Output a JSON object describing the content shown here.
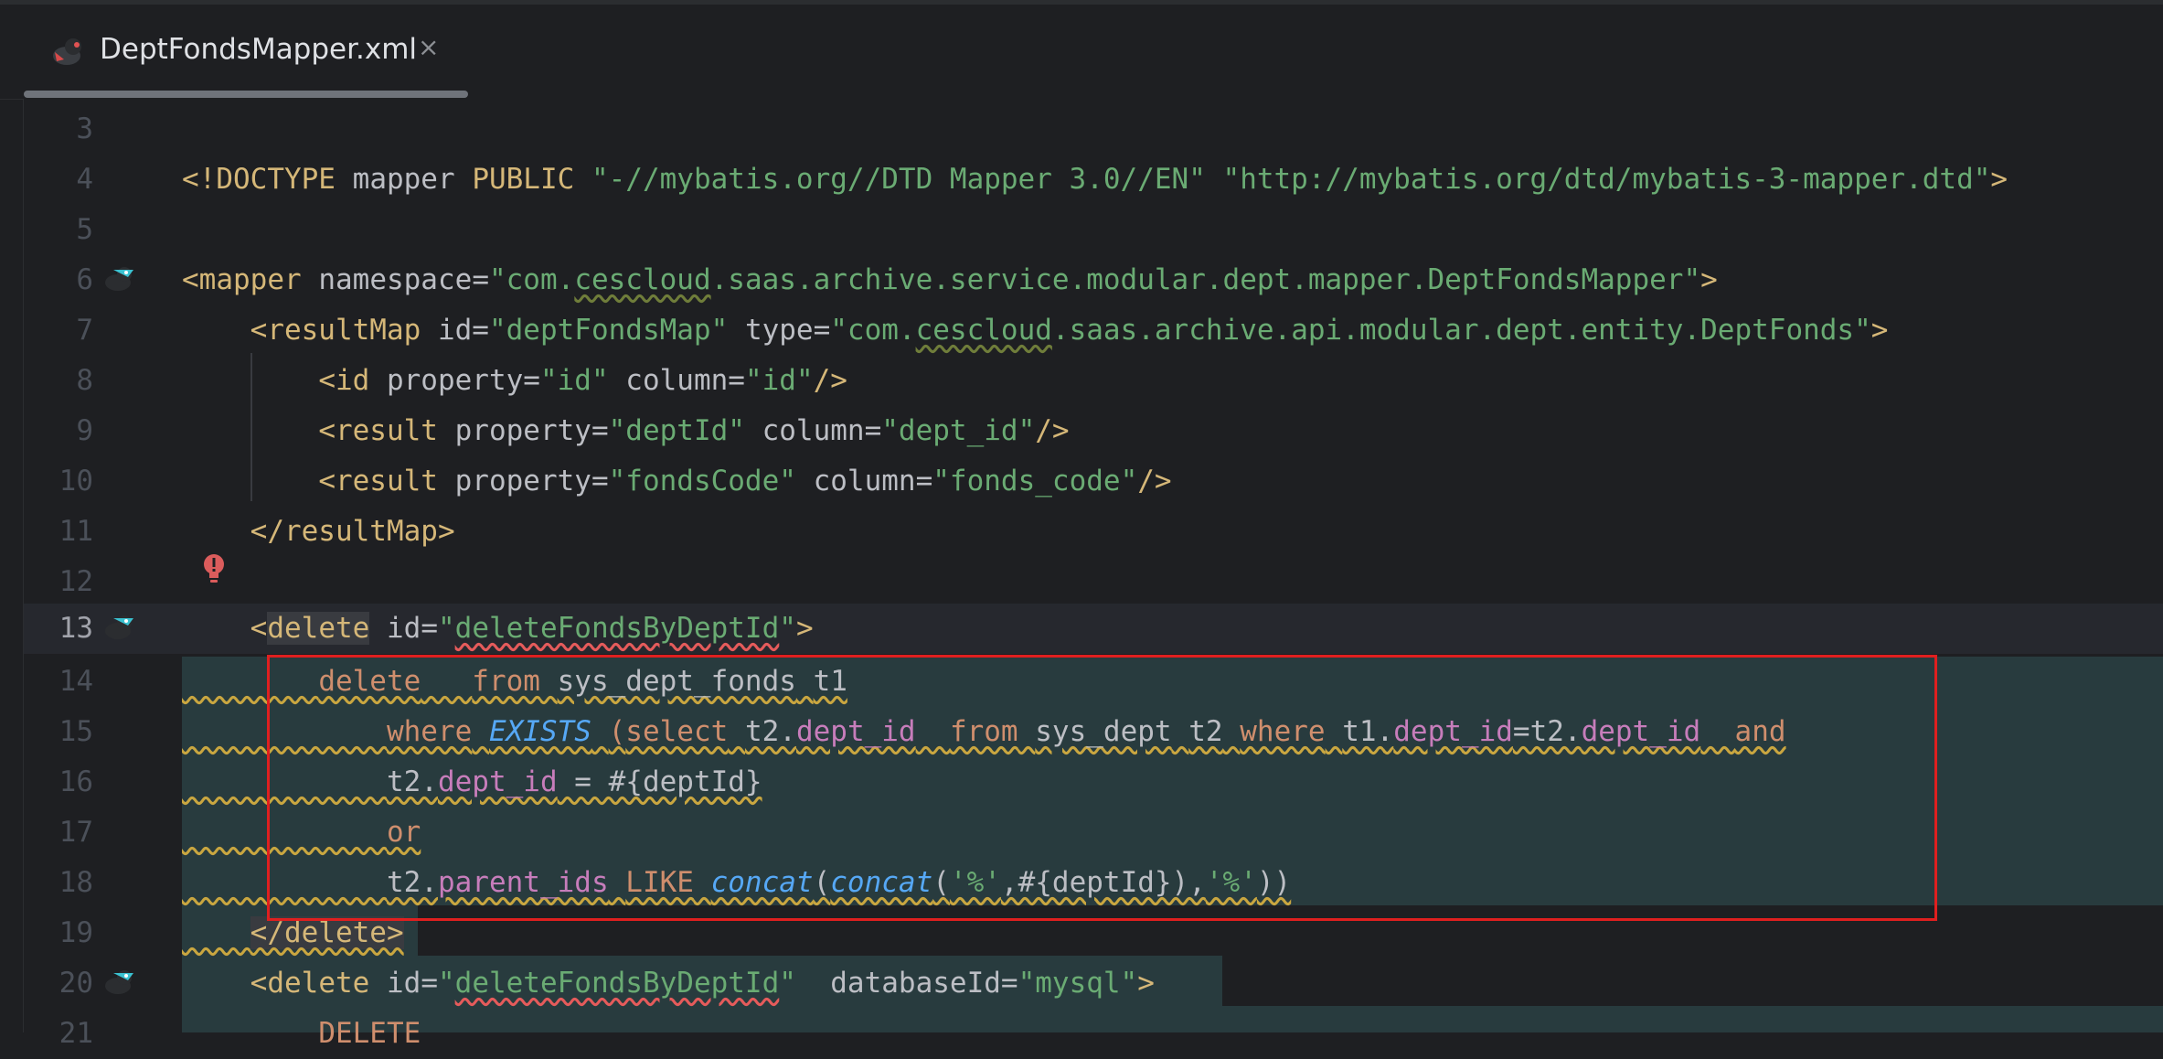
{
  "tab": {
    "title": "DeptFondsMapper.xml",
    "close_glyph": "×",
    "icon": "mybatis-file-icon"
  },
  "colors": {
    "background": "#1e1f22",
    "tag": "#d5b778",
    "string": "#6aab73",
    "keyword": "#cf8e6d",
    "field": "#c77dbb",
    "function": "#56a8f5",
    "injection_background": "#283b3e",
    "highlight_box": "#e01f1f"
  },
  "gutter": {
    "line_numbers": [
      "3",
      "4",
      "5",
      "6",
      "7",
      "8",
      "9",
      "10",
      "11",
      "12",
      "13",
      "14",
      "15",
      "16",
      "17",
      "18",
      "19",
      "20",
      "21"
    ],
    "current_line": "13"
  },
  "code": {
    "l4": {
      "doctype": "<!DOCTYPE",
      "name": "mapper",
      "public": "PUBLIC",
      "fpi": "\"-//mybatis.org//DTD Mapper 3.0//EN\"",
      "uri": "\"http://mybatis.org/dtd/mybatis-3-mapper.dtd\"",
      "close": ">"
    },
    "l6": {
      "tag_open": "<mapper",
      "attr": "namespace",
      "eq": "=",
      "q1": "\"com.",
      "q_err": "cescloud",
      "q2": ".saas.archive.service.modular.dept.mapper.DeptFondsMapper\"",
      "close": ">"
    },
    "l7": {
      "tag_open": "<resultMap",
      "attr_id": "id",
      "eq": "=",
      "val_id": "\"deptFondsMap\"",
      "attr_type": "type",
      "q1": "\"com.",
      "q_err": "cescloud",
      "q2": ".saas.archive.api.modular.dept.entity.DeptFonds\"",
      "close": ">"
    },
    "l8": {
      "tag_open": "<id",
      "attr_prop": "property",
      "eq": "=",
      "val_prop": "\"id\"",
      "attr_col": "column",
      "val_col": "\"id\"",
      "close": "/>"
    },
    "l9": {
      "tag_open": "<result",
      "attr_prop": "property",
      "eq": "=",
      "val_prop": "\"deptId\"",
      "attr_col": "column",
      "val_col": "\"dept_id\"",
      "close": "/>"
    },
    "l10": {
      "tag_open": "<result",
      "attr_prop": "property",
      "eq": "=",
      "val_prop": "\"fondsCode\"",
      "attr_col": "column",
      "val_col": "\"fonds_code\"",
      "close": "/>"
    },
    "l11": {
      "tag_close": "</resultMap>"
    },
    "l13": {
      "lt": "<",
      "name": "delete",
      "attr": "id",
      "eq": "=",
      "q_open": "\"",
      "q_err": "deleteFondsByDeptId",
      "q_close": "\"",
      "close": ">"
    },
    "l14": {
      "kw_delete": "delete",
      "kw_from": "from",
      "table": "sys_dept_fonds",
      "alias": "t1"
    },
    "l15": {
      "kw_where": "where",
      "fn_exists": "EXISTS",
      "paren": "(",
      "kw_select": "select",
      "t2": "t2.",
      "f_dept": "dept_id",
      "kw_from": "from",
      "table": "sys_dept",
      "alias": "t2",
      "kw_where2": "where",
      "t1": "t1.",
      "f_dept2": "dept_id",
      "eq_t2": "=t2.",
      "f_dept3": "dept_id",
      "kw_and": "and"
    },
    "l16": {
      "t2": "t2.",
      "f_dept": "dept_id",
      "rest": " = #{deptId}"
    },
    "l17": {
      "kw_or": "or"
    },
    "l18": {
      "t2": "t2.",
      "f_parent": "parent_ids",
      "kw_like": "LIKE",
      "fn1": "concat",
      "p1": "(",
      "fn2": "concat",
      "p2": "(",
      "s1": "'%'",
      "mid": ",#{deptId}),",
      "s2": "'%'",
      "end": "))"
    },
    "l19": {
      "tag_close": "</delete>"
    },
    "l20": {
      "lt": "<",
      "name": "delete",
      "attr": "id",
      "eq": "=",
      "q_open": "\"",
      "q_err": "deleteFondsByDeptId",
      "q_close": "\"",
      "attr_db": "databaseId",
      "val_db": "\"mysql\"",
      "close": ">"
    },
    "l21": {
      "kw": "DELETE"
    }
  },
  "icons": {
    "gutter_mapper": "mybatis-bird-icon",
    "intention": "red-bulb-icon"
  }
}
